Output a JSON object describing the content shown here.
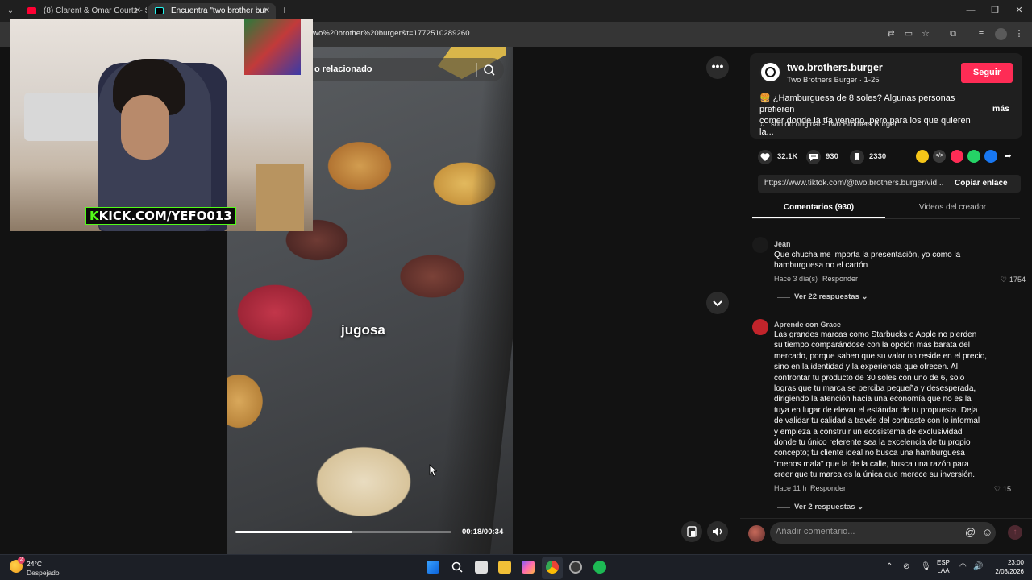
{
  "browser": {
    "tabs": [
      {
        "title": "(8) Clarent & Omar Courtz - Sc"
      },
      {
        "title": "Encuentra \"two brother bur"
      }
    ],
    "url": "wo%20brother%20burger&t=1772510289260"
  },
  "stream_overlay": {
    "channel": "KICK.COM/YEFO013"
  },
  "video": {
    "search_text": "o relacionado",
    "caption": "jugosa",
    "timecode": "00:18/00:34",
    "progress": 0.54
  },
  "post": {
    "handle": "two.brothers.burger",
    "subtitle": "Two Brothers Burger · 1-25",
    "follow_label": "Seguir",
    "description_line1": "🍔 ¿Hamburguesa de 8 soles? Algunas personas prefieren",
    "description_line2": "comer donde la tía veneno, pero para los que quieren la...",
    "more_label": "más",
    "sound": "sonido original - Two Brothers Burger",
    "likes": "32.1K",
    "comments": "930",
    "saves": "2330",
    "link": "https://www.tiktok.com/@two.brothers.burger/vid...",
    "copy_label": "Copiar enlace"
  },
  "panel_tabs": {
    "comments": "Comentarios (930)",
    "videos": "Videos del creador"
  },
  "comments": [
    {
      "name": "Jean",
      "lines": [
        "Que chucha me importa la presentación, yo como la",
        "hamburguesa no el cartón"
      ],
      "time": "Hace 3 día(s)",
      "reply": "Responder",
      "likes": "1754",
      "more": "Ver 22 respuestas"
    },
    {
      "name": "Aprende con Grace",
      "lines": [
        "Las grandes marcas como Starbucks o Apple no pierden",
        "su tiempo comparándose con la opción más barata del",
        "mercado, porque saben que su valor no reside en el precio,",
        "sino en la identidad y la experiencia que ofrecen. Al",
        "confrontar tu producto de 30 soles con uno de 6, solo",
        "logras que tu marca se perciba pequeña y desesperada,",
        "dirigiendo la atención hacia una economía que no es la",
        "tuya en lugar de elevar el estándar de tu propuesta. Deja",
        "de validar tu calidad a través del contraste con lo informal",
        "y empieza a construir un ecosistema de exclusividad",
        "donde tu único referente sea la excelencia de tu propio",
        "concepto; tu cliente ideal no busca una hamburguesa",
        "\"menos mala\" que la de la calle, busca una razón para",
        "creer que tu marca es la única que merece su inversión."
      ],
      "time": "Hace 11 h",
      "reply": "Responder",
      "likes": "15",
      "more": "Ver 2 respuestas"
    }
  ],
  "comment_input": {
    "placeholder": "Añadir comentario..."
  },
  "taskbar": {
    "temp": "24°C",
    "weather": "Despejado",
    "notification_count": "2",
    "lang_line1": "ESP",
    "lang_line2": "LAA",
    "time": "23:00",
    "date": "2/03/2026"
  },
  "colors": {
    "follow": "#fe2c55",
    "kick_green": "#53fc18"
  }
}
